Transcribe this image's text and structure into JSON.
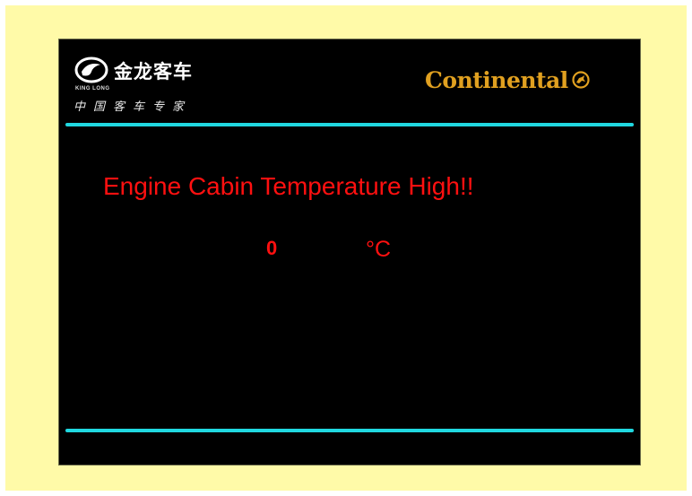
{
  "header": {
    "brand_cn": "金龙客车",
    "brand_en": "KING LONG",
    "slogan": "中国客车专家",
    "partner_logo_text": "Continental",
    "partner_icon": "horse-emblem-icon"
  },
  "alarm": {
    "message": "Engine Cabin Temperature High!!",
    "value": "0",
    "unit": "°C"
  },
  "colors": {
    "screen_bg": "#000000",
    "outer_bg": "#FFFAA8",
    "rule": "#20D8E0",
    "alarm_text": "#FF1010",
    "partner_logo": "#E0A020"
  }
}
